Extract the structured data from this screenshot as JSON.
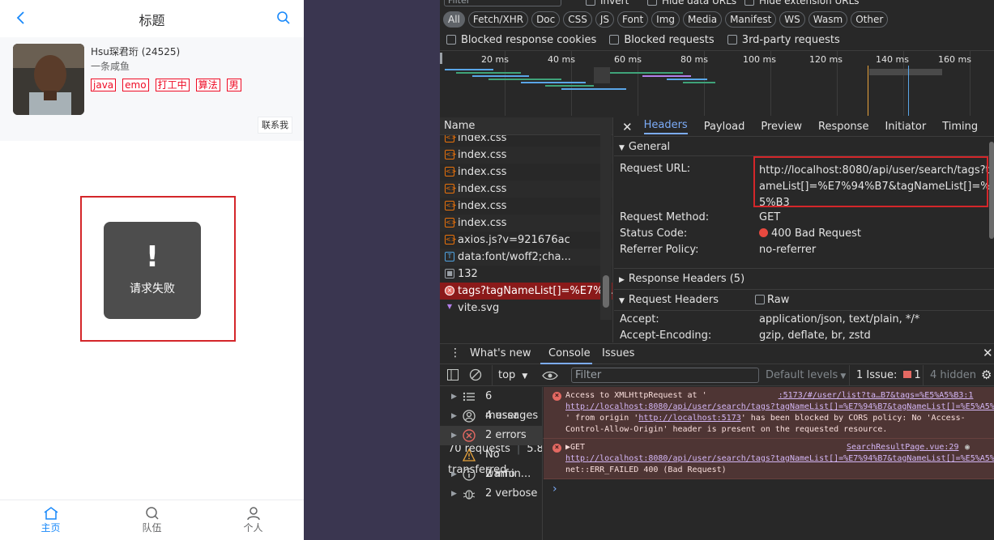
{
  "mobile": {
    "nav_title": "标题",
    "user_title": "Hsu琛君珩 (24525)",
    "user_desc": "一条咸鱼",
    "tags": [
      "java",
      "emo",
      "打工中",
      "算法",
      "男"
    ],
    "contact_label": "联系我",
    "toast_icon": "!",
    "toast_text": "请求失败",
    "tabbar": [
      {
        "label": "主页",
        "icon": "home-icon"
      },
      {
        "label": "队伍",
        "icon": "search-icon"
      },
      {
        "label": "个人",
        "icon": "user-icon"
      }
    ]
  },
  "devtools": {
    "top_filter_placeholder": "Filter",
    "top_checks": [
      "Invert",
      "Hide data URLs",
      "Hide extension URLs"
    ],
    "type_chips": [
      "All",
      "Fetch/XHR",
      "Doc",
      "CSS",
      "JS",
      "Font",
      "Img",
      "Media",
      "Manifest",
      "WS",
      "Wasm",
      "Other"
    ],
    "checks2": [
      "Blocked response cookies",
      "Blocked requests",
      "3rd-party requests"
    ],
    "timeline_labels": [
      "20 ms",
      "40 ms",
      "60 ms",
      "80 ms",
      "100 ms",
      "120 ms",
      "140 ms",
      "160 ms"
    ],
    "name_header": "Name",
    "requests": [
      {
        "name": "index.css",
        "type": "css"
      },
      {
        "name": "index.css",
        "type": "css"
      },
      {
        "name": "index.css",
        "type": "css"
      },
      {
        "name": "index.css",
        "type": "css"
      },
      {
        "name": "index.css",
        "type": "css"
      },
      {
        "name": "index.css",
        "type": "css"
      },
      {
        "name": "axios.js?v=921676ac",
        "type": "js"
      },
      {
        "name": "data:font/woff2;cha...",
        "type": "font"
      },
      {
        "name": "132",
        "type": "img"
      },
      {
        "name": "tags?tagNameList[]=%E7%9...",
        "type": "error"
      },
      {
        "name": "vite.svg",
        "type": "svg"
      }
    ],
    "footer_requests": "70 requests",
    "footer_transferred": "5.8 kB transferred",
    "detail_tabs": [
      "Headers",
      "Payload",
      "Preview",
      "Response",
      "Initiator",
      "Timing"
    ],
    "general_label": "General",
    "request_url_label": "Request URL:",
    "request_url_lines": [
      "http://localhost:8080/api/user/search/tags?tagN",
      "ameList[]=%E7%94%B7&tagNameList[]=%E5%A",
      "5%B3"
    ],
    "request_method_label": "Request Method:",
    "request_method": "GET",
    "status_code_label": "Status Code:",
    "status_code": "400 Bad Request",
    "referrer_policy_label": "Referrer Policy:",
    "referrer_policy": "no-referrer",
    "response_headers_label": "Response Headers (5)",
    "request_headers_label": "Request Headers",
    "raw_label": "Raw",
    "accept_label": "Accept:",
    "accept_value": "application/json, text/plain, */*",
    "accept_encoding_label": "Accept-Encoding:",
    "accept_encoding_value": "gzip, deflate, br, zstd",
    "console_tabs": [
      "What's new",
      "Console",
      "Issues"
    ],
    "context": "top",
    "console_filter_placeholder": "Filter",
    "default_levels": "Default levels",
    "issues_label": "1 Issue:",
    "issues_count": "1",
    "hidden_label": "4 hidden",
    "side_items": [
      {
        "label": "6 messages",
        "icon": "list-icon"
      },
      {
        "label": "4 user me...",
        "icon": "user-circle-icon"
      },
      {
        "label": "2 errors",
        "icon": "error-icon"
      },
      {
        "label": "No warnin...",
        "icon": "warning-icon"
      },
      {
        "label": "2 info",
        "icon": "info-icon"
      },
      {
        "label": "2 verbose",
        "icon": "bug-icon"
      }
    ],
    "msg1": {
      "l1_pre": "Access to XMLHttpRequest at '",
      "l1_link": ":5173/#/user/list?ta…B7&tags=%E5%A5%B3:1",
      "l2_link": "http://localhost:8080/api/user/search/tags?tagNameList[]=%E7%94%B7&tagNameList[]=%E5%A5%B3",
      "l3_pre": "' from origin '",
      "l3_link": "http://localhost:5173",
      "l3_post": "' has been blocked by CORS policy: No 'Access-",
      "l4": "Control-Allow-Origin' header is present on the requested resource."
    },
    "msg2": {
      "l1": "▶GET",
      "source": "SearchResultPage.vue:29",
      "l2_link": "http://localhost:8080/api/user/search/tags?tagNameList[]=%E7%94%B7&tagNameList[]=%E5%A5%B3",
      "l3": "net::ERR_FAILED 400 (Bad Request)"
    },
    "prompt": "›"
  },
  "colors": {
    "accent": "#1989fa",
    "error": "#ee0a24",
    "highlight_box": "#d4262a",
    "devtools_bg": "#282828"
  }
}
